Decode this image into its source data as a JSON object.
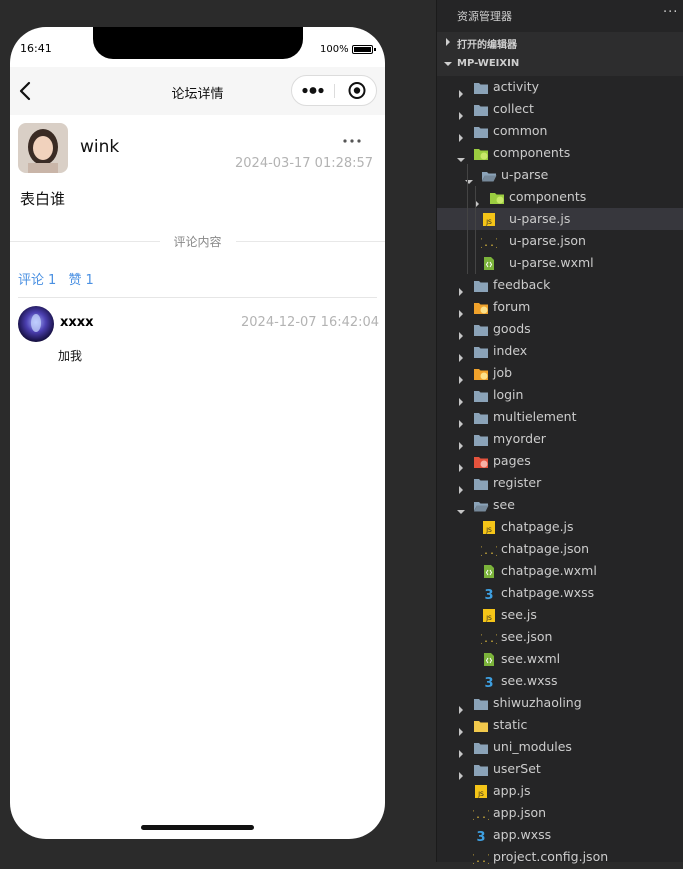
{
  "phone": {
    "status_time": "16:41",
    "battery_percent": "100%",
    "nav_title": "论坛详情",
    "post": {
      "username": "wink",
      "more": "···",
      "time": "2024-03-17 01:28:57",
      "content": "表白谁"
    },
    "divider_label": "评论内容",
    "stats": {
      "comments_label": "评论",
      "comments_count": "1",
      "likes_label": "赞",
      "likes_count": "1"
    },
    "comment": {
      "username": "xxxx",
      "time": "2024-12-07 16:42:04",
      "text": "加我"
    }
  },
  "explorer": {
    "title": "资源管理器",
    "more": "···",
    "open_editors": "打开的编辑器",
    "project": "MP-WEIXIN",
    "items": [
      {
        "label": "activity",
        "icon": "folder-icon",
        "depth": 0,
        "expanded": false
      },
      {
        "label": "collect",
        "icon": "folder-icon",
        "depth": 0,
        "expanded": false
      },
      {
        "label": "common",
        "icon": "folder-icon",
        "depth": 0,
        "expanded": false
      },
      {
        "label": "components",
        "icon": "folder-components-icon",
        "depth": 0,
        "expanded": true
      },
      {
        "label": "u-parse",
        "icon": "folder-open-icon",
        "depth": 1,
        "expanded": true
      },
      {
        "label": "components",
        "icon": "folder-components-icon",
        "depth": 2,
        "expanded": false
      },
      {
        "label": "u-parse.js",
        "icon": "js-file-icon",
        "depth": 2,
        "file": true,
        "selected": true
      },
      {
        "label": "u-parse.json",
        "icon": "json-file-icon",
        "depth": 2,
        "file": true
      },
      {
        "label": "u-parse.wxml",
        "icon": "wxml-file-icon",
        "depth": 2,
        "file": true
      },
      {
        "label": "feedback",
        "icon": "folder-icon",
        "depth": 0,
        "expanded": false
      },
      {
        "label": "forum",
        "icon": "folder-orange-icon",
        "depth": 0,
        "expanded": false
      },
      {
        "label": "goods",
        "icon": "folder-icon",
        "depth": 0,
        "expanded": false
      },
      {
        "label": "index",
        "icon": "folder-icon",
        "depth": 0,
        "expanded": false
      },
      {
        "label": "job",
        "icon": "folder-orange-icon",
        "depth": 0,
        "expanded": false
      },
      {
        "label": "login",
        "icon": "folder-icon",
        "depth": 0,
        "expanded": false
      },
      {
        "label": "multielement",
        "icon": "folder-icon",
        "depth": 0,
        "expanded": false
      },
      {
        "label": "myorder",
        "icon": "folder-icon",
        "depth": 0,
        "expanded": false
      },
      {
        "label": "pages",
        "icon": "folder-red-icon",
        "depth": 0,
        "expanded": false
      },
      {
        "label": "register",
        "icon": "folder-icon",
        "depth": 0,
        "expanded": false
      },
      {
        "label": "see",
        "icon": "folder-open-icon",
        "depth": 0,
        "expanded": true
      },
      {
        "label": "chatpage.js",
        "icon": "js-file-icon",
        "depth": 1,
        "file": true
      },
      {
        "label": "chatpage.json",
        "icon": "json-file-icon",
        "depth": 1,
        "file": true
      },
      {
        "label": "chatpage.wxml",
        "icon": "wxml-file-icon",
        "depth": 1,
        "file": true
      },
      {
        "label": "chatpage.wxss",
        "icon": "wxss-file-icon",
        "depth": 1,
        "file": true
      },
      {
        "label": "see.js",
        "icon": "js-file-icon",
        "depth": 1,
        "file": true
      },
      {
        "label": "see.json",
        "icon": "json-file-icon",
        "depth": 1,
        "file": true
      },
      {
        "label": "see.wxml",
        "icon": "wxml-file-icon",
        "depth": 1,
        "file": true
      },
      {
        "label": "see.wxss",
        "icon": "wxss-file-icon",
        "depth": 1,
        "file": true
      },
      {
        "label": "shiwuzhaoling",
        "icon": "folder-icon",
        "depth": 0,
        "expanded": false
      },
      {
        "label": "static",
        "icon": "folder-yellow-icon",
        "depth": 0,
        "expanded": false
      },
      {
        "label": "uni_modules",
        "icon": "folder-icon",
        "depth": 0,
        "expanded": false
      },
      {
        "label": "userSet",
        "icon": "folder-icon",
        "depth": 0,
        "expanded": false
      },
      {
        "label": "app.js",
        "icon": "js-file-icon",
        "depth": 0,
        "file": true
      },
      {
        "label": "app.json",
        "icon": "json-file-icon",
        "depth": 0,
        "file": true
      },
      {
        "label": "app.wxss",
        "icon": "wxss-file-icon",
        "depth": 0,
        "file": true
      },
      {
        "label": "project.config.json",
        "icon": "json-file-icon",
        "depth": 0,
        "file": true
      }
    ]
  },
  "colors": {
    "link_blue": "#4a90e2",
    "folder_grey": "#8ba3b8",
    "folder_green": "#9bcd40",
    "folder_orange": "#f0a22b",
    "folder_red": "#e5533d",
    "folder_yellow": "#f2c94c",
    "js_yellow": "#f5c518",
    "json_yellow": "#e8c23f",
    "wxml_green": "#7bb33a",
    "wxss_blue": "#3e9fe0"
  }
}
